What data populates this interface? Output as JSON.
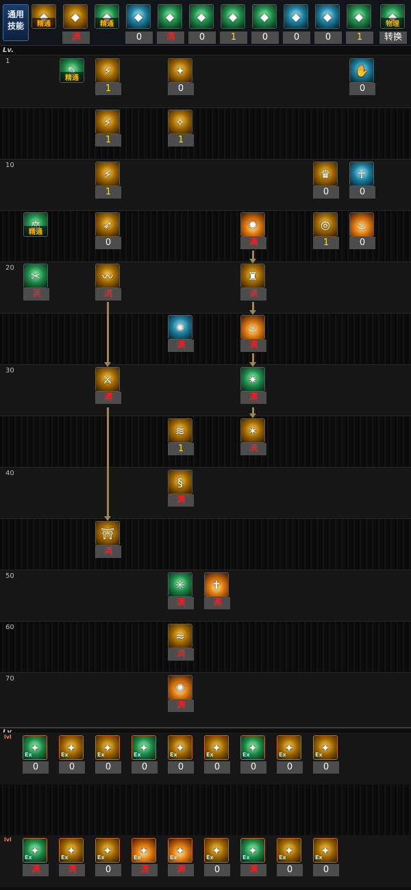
{
  "header": {
    "common_label": "通用\n技能",
    "top_icons": [
      {
        "name": "mastery-icon",
        "badge": "精通",
        "count": ""
      },
      {
        "name": "skill-a-icon",
        "badge": "",
        "count": "满"
      },
      {
        "name": "skill-b-icon",
        "badge": "精通",
        "count": ""
      },
      {
        "name": "wing-icon",
        "badge": "",
        "count": "0"
      },
      {
        "name": "target-icon",
        "badge": "",
        "count": "满"
      },
      {
        "name": "target2-icon",
        "badge": "",
        "count": "0"
      },
      {
        "name": "swing-icon",
        "badge": "",
        "count": "1"
      },
      {
        "name": "kneel-icon",
        "badge": "",
        "count": "0"
      },
      {
        "name": "eye-icon",
        "badge": "",
        "count": "0"
      },
      {
        "name": "body-icon",
        "badge": "",
        "count": "0"
      },
      {
        "name": "run-icon",
        "badge": "",
        "count": "1"
      },
      {
        "name": "switch-icon",
        "badge": "物理",
        "count": "转换"
      }
    ]
  },
  "tree": {
    "lv_header": "Lv.",
    "levels": [
      "1",
      "",
      "10",
      "",
      "20",
      "",
      "30",
      "",
      "40",
      "",
      "50",
      "60",
      "70"
    ],
    "skills": [
      {
        "id": "s1",
        "cls": "green",
        "glyph": "✎",
        "badge": "精通",
        "count": ""
      },
      {
        "id": "s2",
        "cls": "gold",
        "glyph": "⚡",
        "badge": "",
        "count": "1"
      },
      {
        "id": "s3",
        "cls": "gold",
        "glyph": "✦",
        "badge": "",
        "count": "0"
      },
      {
        "id": "s4",
        "cls": "cyan",
        "glyph": "✋",
        "badge": "",
        "count": "0"
      },
      {
        "id": "s5",
        "cls": "gold",
        "glyph": "⚡",
        "badge": "",
        "count": "1"
      },
      {
        "id": "s6",
        "cls": "gold",
        "glyph": "✧",
        "badge": "",
        "count": "1"
      },
      {
        "id": "s7",
        "cls": "gold",
        "glyph": "⚡",
        "badge": "",
        "count": "1"
      },
      {
        "id": "s8",
        "cls": "gold",
        "glyph": "♛",
        "badge": "",
        "count": "0"
      },
      {
        "id": "s9",
        "cls": "cyan",
        "glyph": "☥",
        "badge": "",
        "count": "0"
      },
      {
        "id": "s10",
        "cls": "green",
        "glyph": "⚖",
        "badge": "精通",
        "count": ""
      },
      {
        "id": "s11",
        "cls": "gold",
        "glyph": "➶",
        "badge": "",
        "count": "0"
      },
      {
        "id": "s12",
        "cls": "fire",
        "glyph": "✹",
        "badge": "",
        "count": "满"
      },
      {
        "id": "s13",
        "cls": "gold",
        "glyph": "◎",
        "badge": "",
        "count": "1"
      },
      {
        "id": "s14",
        "cls": "fire",
        "glyph": "♨",
        "badge": "",
        "count": "0"
      },
      {
        "id": "s15",
        "cls": "green",
        "glyph": "✂",
        "badge": "",
        "count": "满"
      },
      {
        "id": "s16",
        "cls": "gold",
        "glyph": "〰",
        "badge": "",
        "count": "满"
      },
      {
        "id": "s17",
        "cls": "gold",
        "glyph": "♜",
        "badge": "",
        "count": "满"
      },
      {
        "id": "s18",
        "cls": "cyan",
        "glyph": "✺",
        "badge": "",
        "count": "满"
      },
      {
        "id": "s19",
        "cls": "fire",
        "glyph": "♨",
        "badge": "",
        "count": "满"
      },
      {
        "id": "s20",
        "cls": "gold",
        "glyph": "⚔",
        "badge": "",
        "count": "满"
      },
      {
        "id": "s21",
        "cls": "green",
        "glyph": "✷",
        "badge": "",
        "count": "满"
      },
      {
        "id": "s22",
        "cls": "gold",
        "glyph": "≋",
        "badge": "",
        "count": "1"
      },
      {
        "id": "s23",
        "cls": "gold",
        "glyph": "✶",
        "badge": "",
        "count": "满"
      },
      {
        "id": "s24",
        "cls": "gold",
        "glyph": "§",
        "badge": "",
        "count": "满"
      },
      {
        "id": "s25",
        "cls": "gold",
        "glyph": "⛩",
        "badge": "",
        "count": "满"
      },
      {
        "id": "s26",
        "cls": "green",
        "glyph": "✳",
        "badge": "",
        "count": "满"
      },
      {
        "id": "s27",
        "cls": "fire",
        "glyph": "✝",
        "badge": "",
        "count": "满"
      },
      {
        "id": "s28",
        "cls": "gold",
        "glyph": "≈",
        "badge": "",
        "count": "满"
      },
      {
        "id": "s29",
        "cls": "fire",
        "glyph": "✺",
        "badge": "",
        "count": "满"
      }
    ]
  },
  "ex": {
    "lv_header": "Lv.",
    "row_labels": [
      "lvl",
      "lvl"
    ],
    "row1": [
      "0",
      "0",
      "0",
      "0",
      "0",
      "0",
      "0",
      "0",
      "0"
    ],
    "row2": [
      "满",
      "满",
      "0",
      "满",
      "满",
      "0",
      "满",
      "0",
      "0"
    ],
    "badge": "Ex"
  },
  "colors": {
    "full": "#ff2424",
    "one": "#ffe400",
    "count_bg": "#4c4c4c",
    "connector": "#9a8658"
  }
}
